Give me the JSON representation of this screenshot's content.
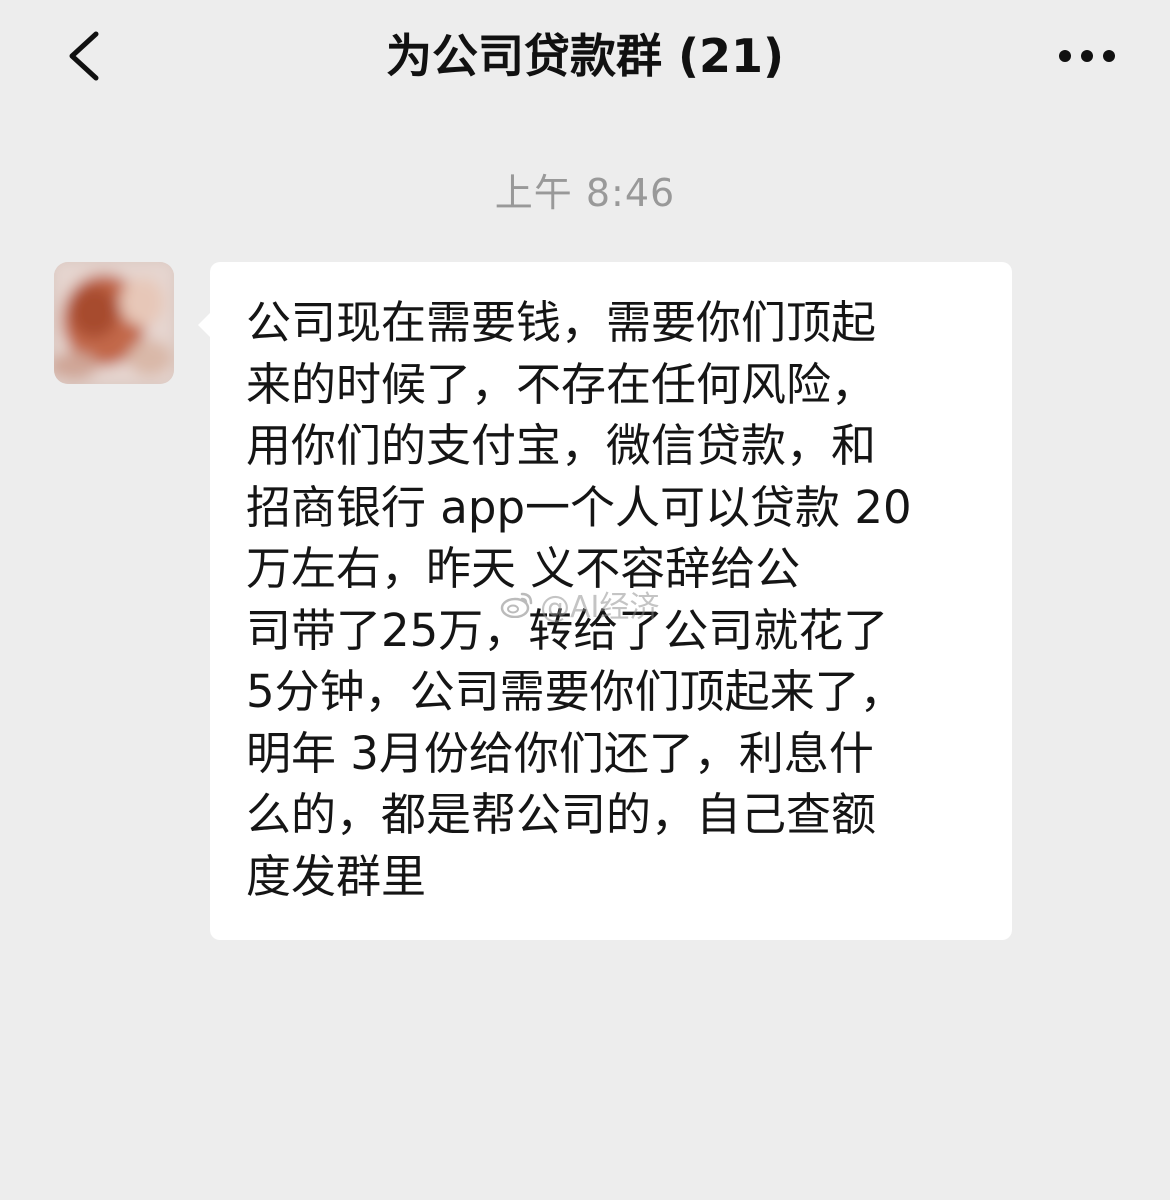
{
  "header": {
    "back_icon": "chevron-left-icon",
    "title": "为公司贷款群 (21)",
    "more_icon": "more-dots-icon"
  },
  "chat": {
    "timestamp": "上午 8:46",
    "message": {
      "sender_avatar": "blurred-avatar",
      "text": "公司现在需要钱，需要你们顶起\n来的时候了，不存在任何风险，\n用你们的支付宝，微信贷款，和\n招商银行 app一个人可以贷款 20\n万左右，昨天      义不容辞给公\n司带了25万，转给了公司就花了\n5分钟，公司需要你们顶起来了，\n明年 3月份给你们还了，利息什\n么的，都是帮公司的，自己查额\n度发群里"
    }
  },
  "watermark": {
    "icon": "weibo-icon",
    "text": "@AI经济"
  },
  "colors": {
    "background": "#ededed",
    "bubble": "#ffffff",
    "text": "#151515",
    "timestamp": "#999999"
  }
}
